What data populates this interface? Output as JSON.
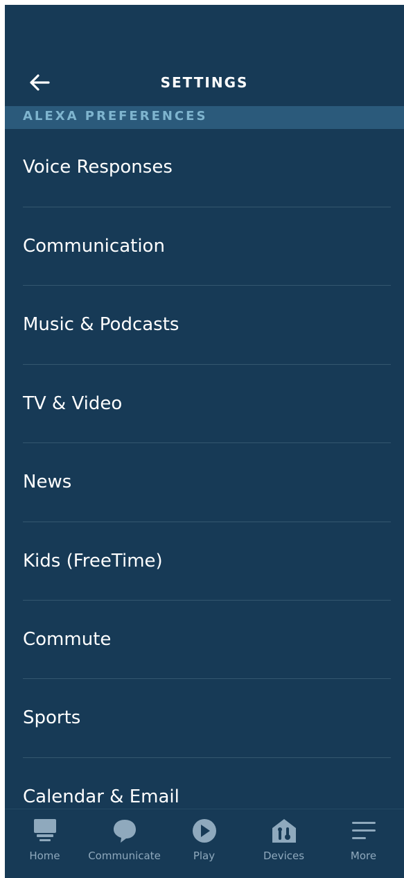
{
  "header": {
    "title": "SETTINGS",
    "back_icon": "back-arrow-icon"
  },
  "section": {
    "title": "ALEXA PREFERENCES"
  },
  "items": [
    {
      "label": "Voice Responses"
    },
    {
      "label": "Communication"
    },
    {
      "label": "Music & Podcasts"
    },
    {
      "label": "TV & Video"
    },
    {
      "label": "News"
    },
    {
      "label": "Kids (FreeTime)"
    },
    {
      "label": "Commute"
    },
    {
      "label": "Sports"
    },
    {
      "label": "Calendar & Email"
    }
  ],
  "tabbar": {
    "tabs": [
      {
        "label": "Home",
        "icon": "home-icon"
      },
      {
        "label": "Communicate",
        "icon": "communicate-icon"
      },
      {
        "label": "Play",
        "icon": "play-icon"
      },
      {
        "label": "Devices",
        "icon": "devices-icon"
      },
      {
        "label": "More",
        "icon": "menu-icon"
      }
    ]
  },
  "colors": {
    "background": "#173a56",
    "section_bar": "#2b5a7b",
    "section_text": "#7fb5cf",
    "tab_inactive": "#8fa9bd"
  }
}
